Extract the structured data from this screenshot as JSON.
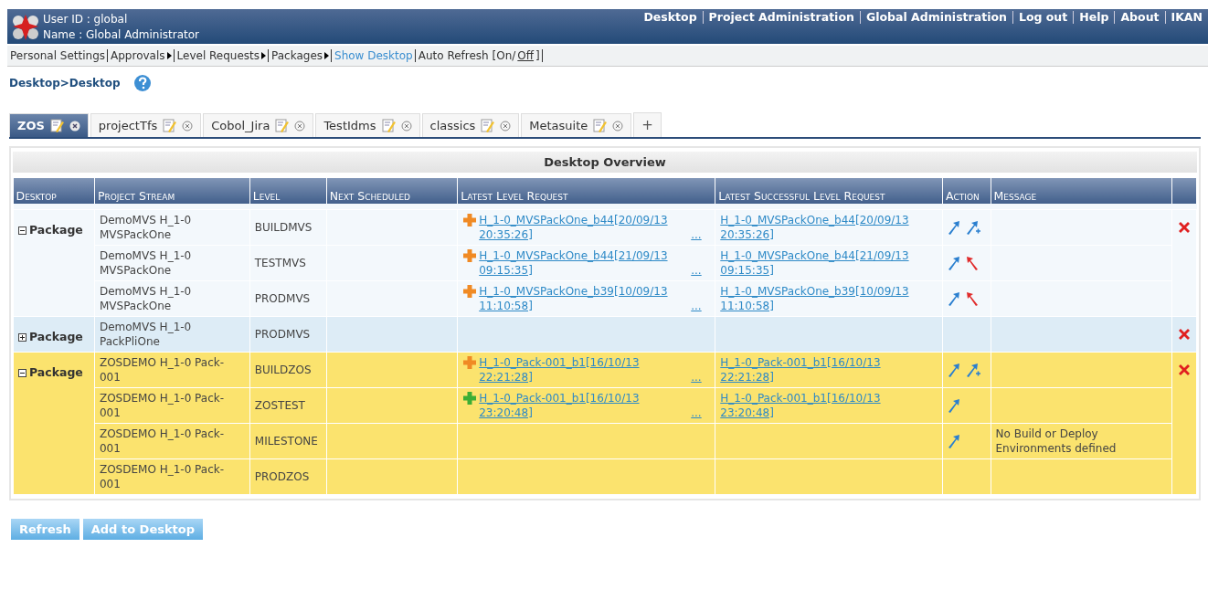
{
  "header": {
    "user_id": "User ID : global",
    "user_name": "Name : Global Administrator",
    "links": [
      "Desktop",
      "Project Administration",
      "Global Administration",
      "Log out",
      "Help",
      "About",
      "IKAN"
    ]
  },
  "menu": [
    {
      "kind": "plain",
      "label": "Personal Settings",
      "selected": false
    },
    {
      "kind": "submenu",
      "label": "Approvals",
      "selected": false
    },
    {
      "kind": "submenu",
      "label": "Level Requests",
      "selected": false
    },
    {
      "kind": "submenu",
      "label": "Packages",
      "selected": false
    },
    {
      "kind": "plain",
      "label": "Show Desktop",
      "selected": true
    },
    {
      "kind": "toggle",
      "label": "Auto Refresh [On/",
      "link": "Off",
      "after": "]",
      "selected": false
    }
  ],
  "breadcrumb": "Desktop>Desktop",
  "tabs": [
    {
      "label": "ZOS",
      "selected": true
    },
    {
      "label": "projectTfs",
      "selected": false
    },
    {
      "label": "Cobol_Jira",
      "selected": false
    },
    {
      "label": "TestIdms",
      "selected": false
    },
    {
      "label": "classics",
      "selected": false
    },
    {
      "label": "Metasuite",
      "selected": false
    }
  ],
  "add_tab": "+",
  "panel": {
    "title": "Desktop Overview",
    "columns": [
      "Desktop",
      "Project Stream",
      "Level",
      "Next Scheduled",
      "Latest Level Request",
      "Latest Successful Level Request",
      "Action",
      "Message"
    ],
    "groups": [
      {
        "type": "Package",
        "expanded": true,
        "color": "#f3f8fc",
        "rows": [
          {
            "stream": "DemoMVS H_1-0 MVSPackOne",
            "level": "BUILDMVS",
            "latest": {
              "kind": "running",
              "text": "H_1-0_MVSPackOne_b44[20/09/13 20:35:26]",
              "more": "..."
            },
            "successful": "H_1-0_MVSPackOne_b44[20/09/13 20:35:26]",
            "actions": [
              {
                "kind": "deliver"
              },
              {
                "kind": "deliver-plus"
              }
            ]
          },
          {
            "stream": "DemoMVS H_1-0 MVSPackOne",
            "level": "TESTMVS",
            "latest": {
              "kind": "running",
              "text": "H_1-0_MVSPackOne_b44[21/09/13 09:15:35]",
              "more": "..."
            },
            "successful": "H_1-0_MVSPackOne_b44[21/09/13 09:15:35]",
            "actions": [
              {
                "kind": "deliver"
              },
              {
                "kind": "rollback"
              }
            ]
          },
          {
            "stream": "DemoMVS H_1-0 MVSPackOne",
            "level": "PRODMVS",
            "latest": {
              "kind": "running",
              "text": "H_1-0_MVSPackOne_b39[10/09/13 11:10:58]",
              "more": "..."
            },
            "successful": "H_1-0_MVSPackOne_b39[10/09/13 11:10:58]",
            "actions": [
              {
                "kind": "deliver"
              },
              {
                "kind": "rollback"
              }
            ]
          }
        ]
      },
      {
        "type": "Package",
        "expanded": false,
        "color": "#ddecf6",
        "rows": [
          {
            "stream": "DemoMVS H_1-0 PackPliOne",
            "level": "PRODMVS",
            "actions": []
          }
        ]
      },
      {
        "type": "Package",
        "expanded": true,
        "color": "#fbe36e",
        "rows": [
          {
            "stream": "ZOSDEMO H_1-0 Pack-001",
            "level": "BUILDZOS",
            "latest": {
              "kind": "running",
              "text": "H_1-0_Pack-001_b1[16/10/13 22:21:28]",
              "more": "..."
            },
            "successful": "H_1-0_Pack-001_b1[16/10/13 22:21:28]",
            "actions": [
              {
                "kind": "deliver"
              },
              {
                "kind": "deliver-plus"
              }
            ]
          },
          {
            "stream": "ZOSDEMO H_1-0 Pack-001",
            "level": "ZOSTEST",
            "latest": {
              "kind": "success",
              "text": "H_1-0_Pack-001_b1[16/10/13 23:20:48]",
              "more": "..."
            },
            "successful": "H_1-0_Pack-001_b1[16/10/13 23:20:48]",
            "actions": [
              {
                "kind": "deliver"
              }
            ]
          },
          {
            "stream": "ZOSDEMO H_1-0 Pack-001",
            "level": "MILESTONE",
            "actions": [
              {
                "kind": "deliver"
              }
            ],
            "message": "No Build or Deploy Environments defined"
          },
          {
            "stream": "ZOSDEMO H_1-0 Pack-001",
            "level": "PRODZOS",
            "actions": []
          }
        ]
      }
    ]
  },
  "buttons": [
    "Refresh",
    "Add to Desktop"
  ]
}
